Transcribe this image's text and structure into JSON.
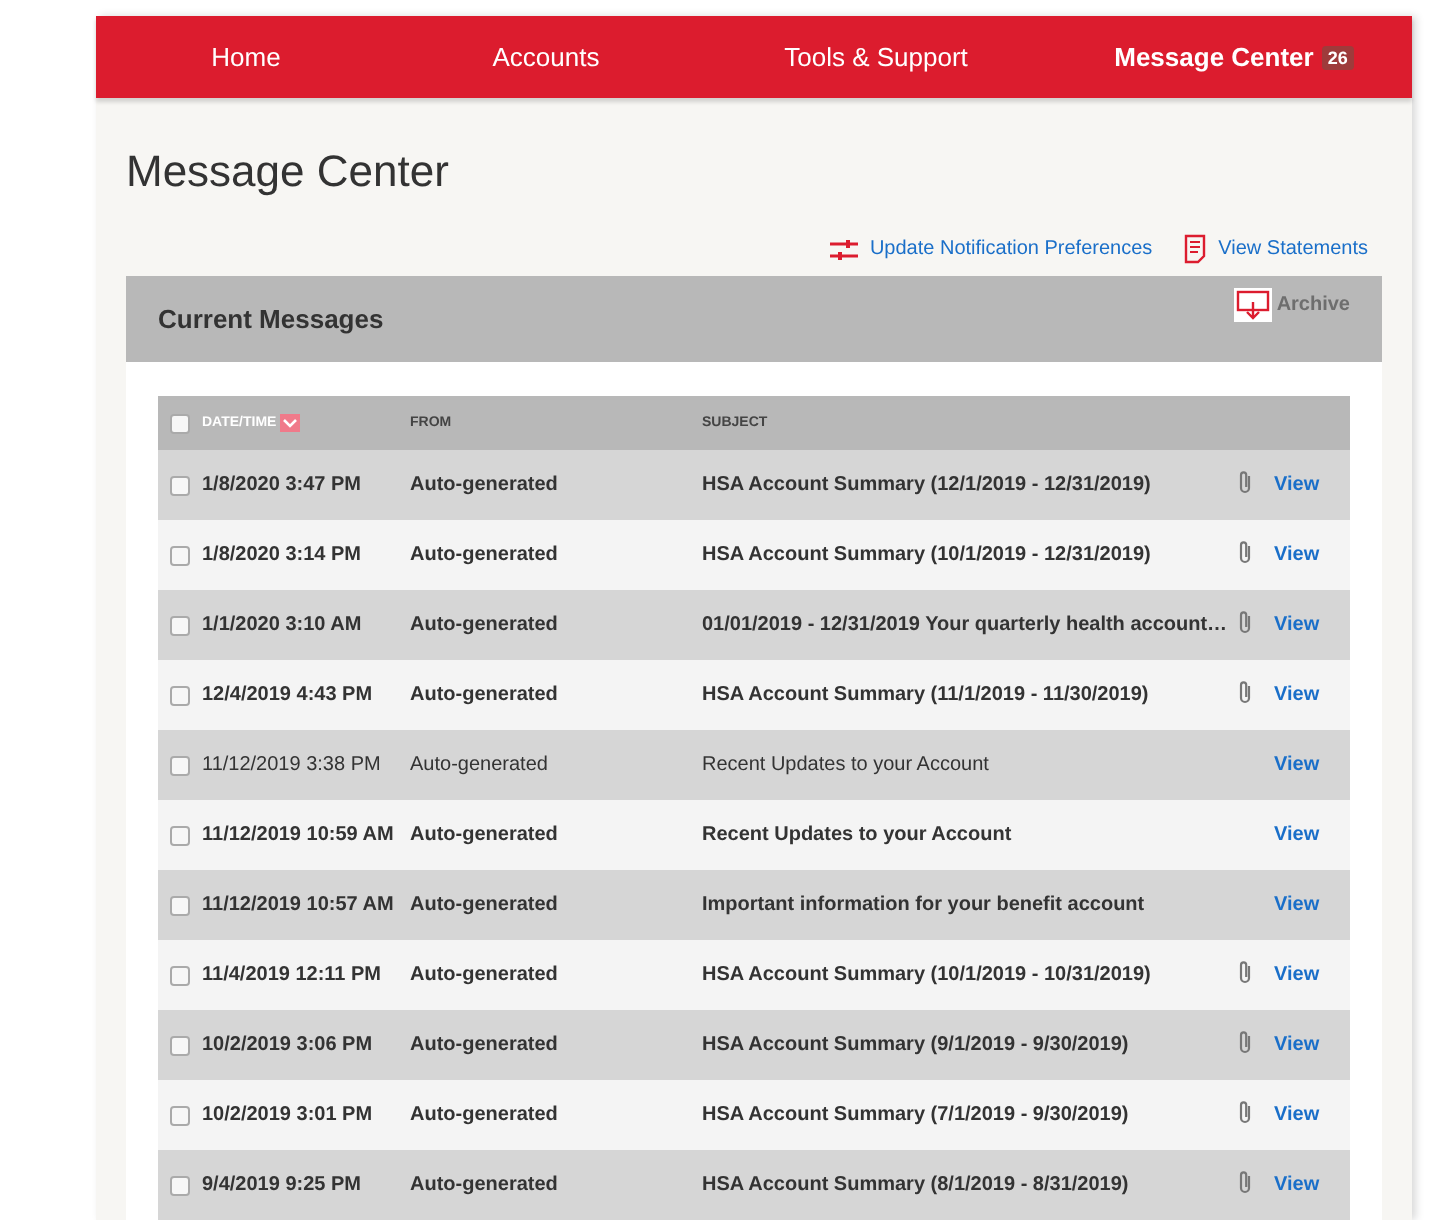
{
  "nav": [
    {
      "label": "Home",
      "selected": false
    },
    {
      "label": "Accounts",
      "selected": false
    },
    {
      "label": "Tools & Support",
      "selected": false
    },
    {
      "label": "Message Center",
      "selected": true,
      "badge": "26"
    }
  ],
  "title": "Message Center",
  "links": [
    {
      "kind": "preferences",
      "label": "Update Notification Preferences"
    },
    {
      "kind": "statements",
      "label": "View Statements"
    }
  ],
  "panel": {
    "title": "Current Messages",
    "archive": {
      "label": "Archive",
      "disabled": true
    }
  },
  "table": {
    "select_all": {
      "checked": false
    },
    "columns": [
      "DATE/TIME",
      "FROM",
      "SUBJECT"
    ],
    "rows": [
      {
        "date": "1/8/2020 3:47 PM",
        "from": "Auto-generated",
        "subject": "HSA Account Summary (12/1/2019 - 12/31/2019)",
        "unread": true,
        "attachment": true,
        "checked": false,
        "action": "View"
      },
      {
        "date": "1/8/2020 3:14 PM",
        "from": "Auto-generated",
        "subject": "HSA Account Summary (10/1/2019 - 12/31/2019)",
        "unread": true,
        "attachment": true,
        "checked": false,
        "action": "View"
      },
      {
        "date": "1/1/2020 3:10 AM",
        "from": "Auto-generated",
        "subject": "01/01/2019 - 12/31/2019 Your quarterly health account…",
        "unread": true,
        "attachment": true,
        "checked": false,
        "action": "View"
      },
      {
        "date": "12/4/2019 4:43 PM",
        "from": "Auto-generated",
        "subject": "HSA Account Summary (11/1/2019 - 11/30/2019)",
        "unread": true,
        "attachment": true,
        "checked": false,
        "action": "View"
      },
      {
        "date": "11/12/2019 3:38 PM",
        "from": "Auto-generated",
        "subject": "Recent Updates to your Account",
        "unread": false,
        "attachment": false,
        "checked": false,
        "action": "View"
      },
      {
        "date": "11/12/2019 10:59 AM",
        "from": "Auto-generated",
        "subject": "Recent Updates to your Account",
        "unread": true,
        "attachment": false,
        "checked": false,
        "action": "View"
      },
      {
        "date": "11/12/2019 10:57 AM",
        "from": "Auto-generated",
        "subject": "Important information for your benefit account",
        "unread": true,
        "attachment": false,
        "checked": false,
        "action": "View"
      },
      {
        "date": "11/4/2019 12:11 PM",
        "from": "Auto-generated",
        "subject": "HSA Account Summary (10/1/2019 - 10/31/2019)",
        "unread": true,
        "attachment": true,
        "checked": false,
        "action": "View"
      },
      {
        "date": "10/2/2019 3:06 PM",
        "from": "Auto-generated",
        "subject": "HSA Account Summary (9/1/2019 - 9/30/2019)",
        "unread": true,
        "attachment": true,
        "checked": false,
        "action": "View"
      },
      {
        "date": "10/2/2019 3:01 PM",
        "from": "Auto-generated",
        "subject": "HSA Account Summary (7/1/2019 - 9/30/2019)",
        "unread": true,
        "attachment": true,
        "checked": false,
        "action": "View"
      },
      {
        "date": "9/4/2019 9:25 PM",
        "from": "Auto-generated",
        "subject": "HSA Account Summary (8/1/2019 - 8/31/2019)",
        "unread": true,
        "attachment": true,
        "checked": false,
        "action": "View"
      }
    ]
  }
}
